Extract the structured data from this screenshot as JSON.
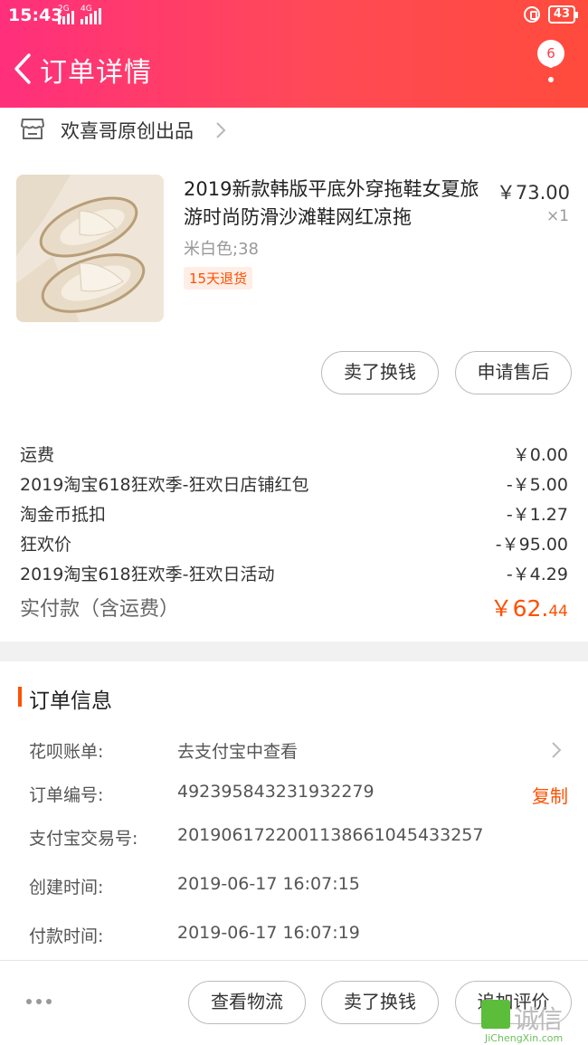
{
  "status_bar": {
    "time": "15:43",
    "net1": "2G",
    "net2": "4G",
    "battery": "43"
  },
  "nav": {
    "title": "订单详情",
    "badge_count": "6"
  },
  "shop": {
    "name": "欢喜哥原创出品"
  },
  "product": {
    "title": "2019新款韩版平底外穿拖鞋女夏旅游时尚防滑沙滩鞋网红凉拖",
    "price": "￥73.00",
    "qty": "×1",
    "sku": "米白色;38",
    "tag": "15天退货"
  },
  "item_actions": {
    "sell_label": "卖了换钱",
    "after_sale_label": "申请售后"
  },
  "fees": [
    {
      "label": "运费",
      "value": "￥0.00"
    },
    {
      "label": "2019淘宝618狂欢季-狂欢日店铺红包",
      "value": "-￥5.00"
    },
    {
      "label": "淘金币抵扣",
      "value": "-￥1.27"
    },
    {
      "label": "狂欢价",
      "value": "-￥95.00"
    },
    {
      "label": "2019淘宝618狂欢季-狂欢日活动",
      "value": "-￥4.29"
    }
  ],
  "total": {
    "label": "实付款（含运费）",
    "value_big": "￥62.",
    "value_small": "44"
  },
  "order_info": {
    "heading": "订单信息",
    "rows": [
      {
        "key": "花呗账单:",
        "value": "去支付宝中查看"
      },
      {
        "key": "订单编号:",
        "value": "492395843231932279",
        "action": "复制"
      },
      {
        "key": "支付宝交易号:",
        "value": "2019061722001138661045433257"
      },
      {
        "key": "创建时间:",
        "value": "2019-06-17 16:07:15"
      },
      {
        "key": "付款时间:",
        "value": "2019-06-17 16:07:19"
      }
    ]
  },
  "bottom_actions": {
    "logistics_label": "查看物流",
    "sell_label": "卖了换钱",
    "review_label": "追加评价"
  },
  "watermark": {
    "text": "诚信",
    "sub": "JiChengXin.com"
  },
  "colors": {
    "accent": "#ff5000",
    "header_start": "#ff2f7c",
    "header_end": "#ff4b3c"
  }
}
